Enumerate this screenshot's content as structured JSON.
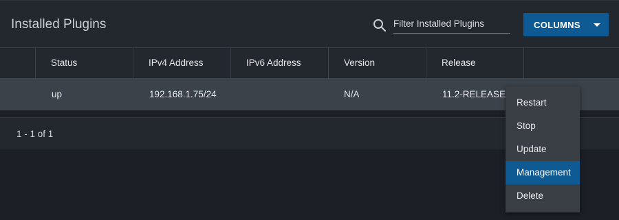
{
  "header": {
    "title": "Installed Plugins",
    "search_placeholder": "Filter Installed Plugins",
    "search_value": "",
    "columns_label": "COLUMNS"
  },
  "table": {
    "columns": [
      "Status",
      "IPv4 Address",
      "IPv6 Address",
      "Version",
      "Release"
    ],
    "rows": [
      {
        "status": "up",
        "ipv4": "192.168.1.75/24",
        "ipv6": "",
        "version": "N/A",
        "release": "11.2-RELEASE-"
      }
    ]
  },
  "footer": {
    "pagination": "1 - 1 of 1"
  },
  "menu": {
    "items": [
      "Restart",
      "Stop",
      "Update",
      "Management",
      "Delete"
    ],
    "active_index": 3
  },
  "colors": {
    "accent": "#0f5a93",
    "background": "#1c2026",
    "panel": "#23282f",
    "row_highlight": "#3c424a"
  }
}
